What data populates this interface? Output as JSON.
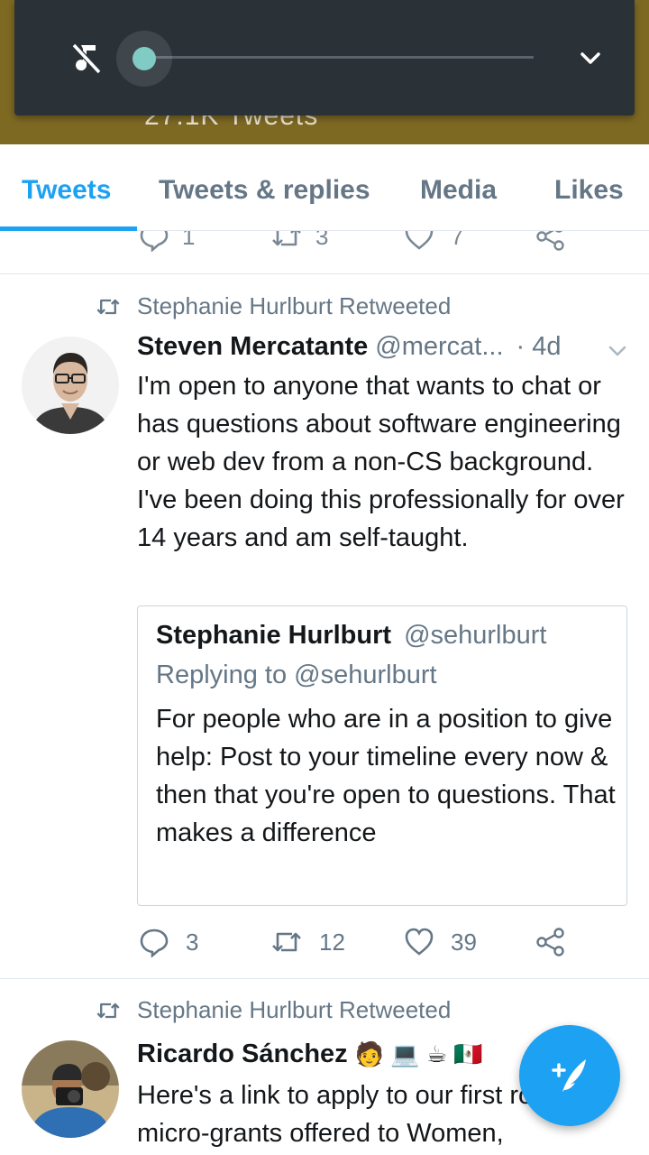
{
  "header": {
    "tweet_count": "27.1K Tweets"
  },
  "media_bar": {
    "progress": 0.0
  },
  "tabs": [
    {
      "label": "Tweets",
      "active": true
    },
    {
      "label": "Tweets & replies",
      "active": false
    },
    {
      "label": "Media",
      "active": false
    },
    {
      "label": "Likes",
      "active": false
    }
  ],
  "prev_tweet": {
    "replies": "1",
    "retweets": "3",
    "likes": "7"
  },
  "tweets": [
    {
      "retweeted_by": "Stephanie Hurlburt Retweeted",
      "name": "Steven Mercatante",
      "handle": "@mercat...",
      "time": "· 4d",
      "text": "I'm open to anyone that wants to chat or has questions about software engineering or web dev from a non-CS background. I've been doing this professionally for over 14 years and am self-taught.",
      "quote": {
        "name": "Stephanie Hurlburt",
        "handle": "@sehurlburt",
        "replying_to": "Replying to @sehurlburt",
        "text": "For people who are in a position to give help: Post to your timeline every now & then that you're open to questions. That makes a difference"
      },
      "replies": "3",
      "retweets": "12",
      "likes": "39"
    },
    {
      "retweeted_by": "Stephanie Hurlburt Retweeted",
      "name": "Ricardo Sánchez",
      "name_emojis": "🧑 💻 ☕ 🇲🇽",
      "text": "Here's a link to apply to our first round of micro-grants offered to Women,"
    }
  ],
  "colors": {
    "accent": "#1da1f2",
    "banner": "#7e6923",
    "media_bar": "#2a3238",
    "slider_thumb": "#80cbc4"
  }
}
